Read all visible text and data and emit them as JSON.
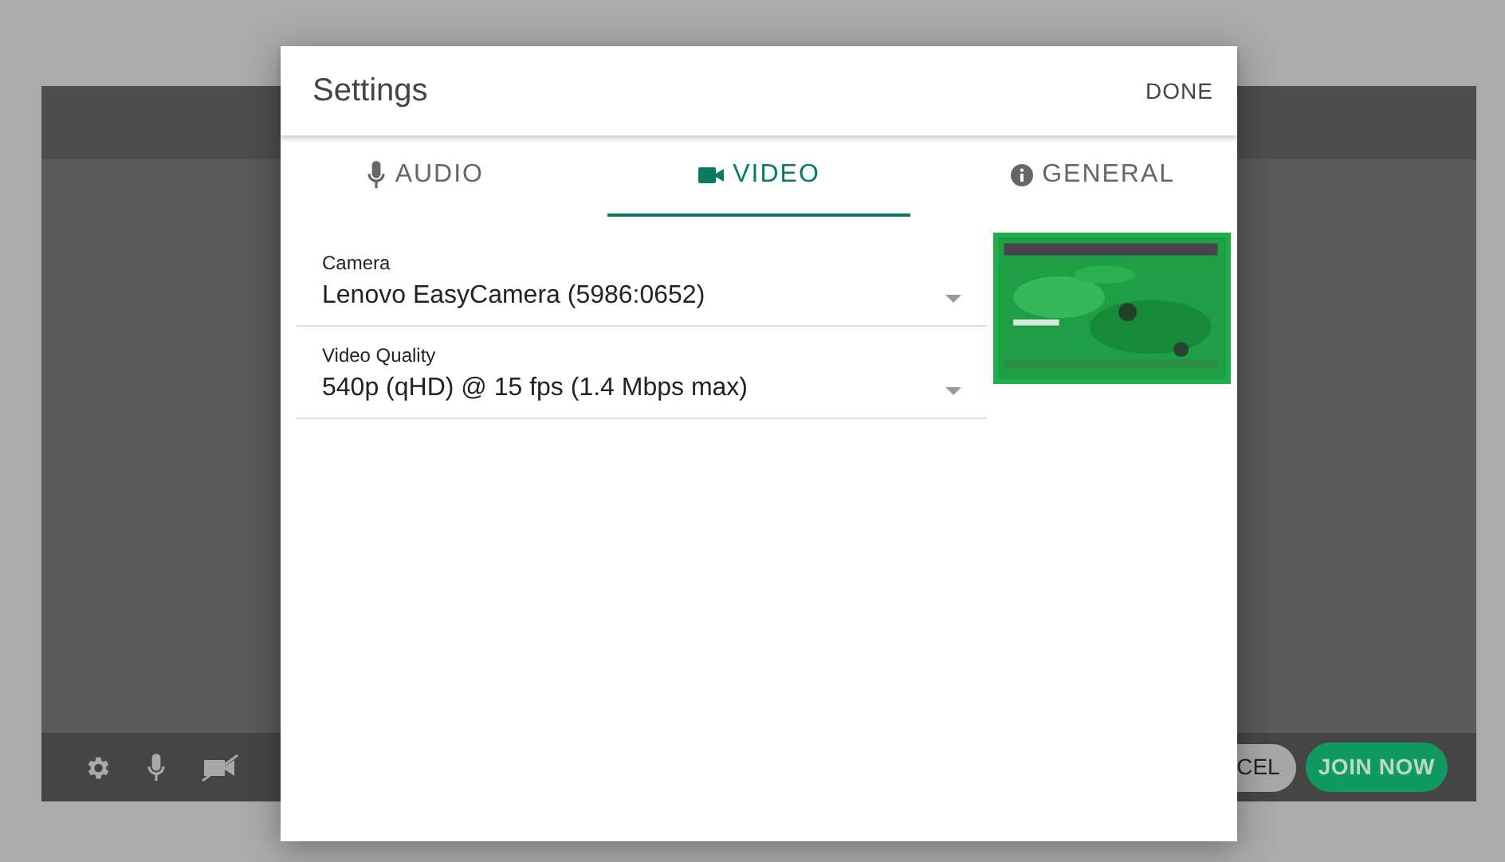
{
  "background": {
    "cancel_button": "CEL",
    "join_button": "JOIN NOW"
  },
  "dialog": {
    "title": "Settings",
    "done": "DONE",
    "tabs": [
      {
        "label": "AUDIO",
        "selected": false
      },
      {
        "label": "VIDEO",
        "selected": true
      },
      {
        "label": "GENERAL",
        "selected": false
      }
    ],
    "fields": [
      {
        "label": "Camera",
        "value": "Lenovo EasyCamera (5986:0652)"
      },
      {
        "label": "Video Quality",
        "value": "540p (qHD) @ 15 fps (1.4 Mbps max)"
      }
    ]
  }
}
